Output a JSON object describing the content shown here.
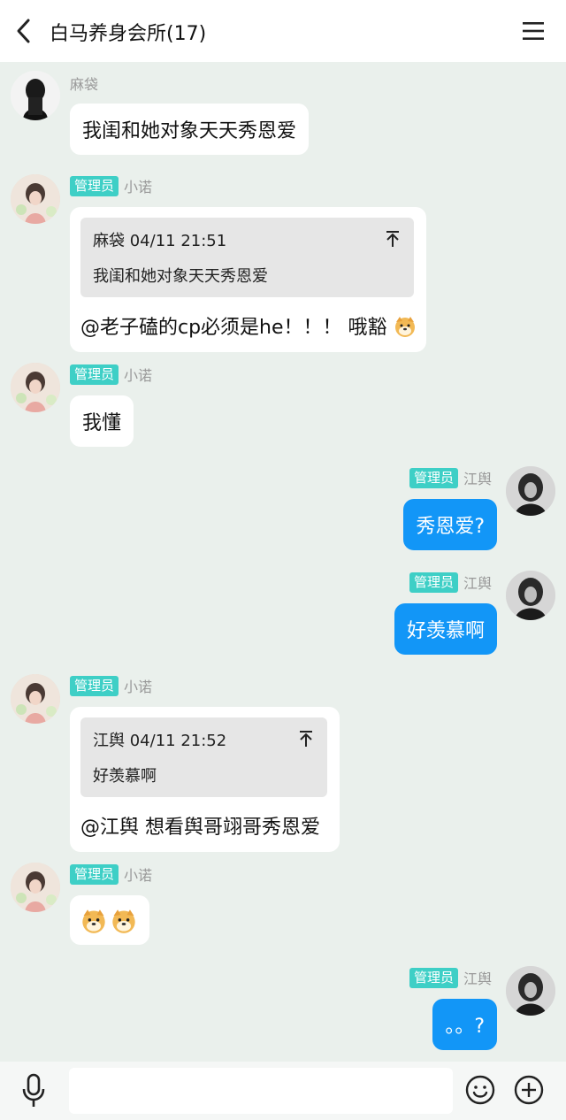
{
  "header": {
    "title": "白马养身会所(17)"
  },
  "messages": [
    {
      "sender": "麻袋",
      "text": "我闺和她对象天天秀恩爱"
    },
    {
      "badge": "管理员",
      "sender": "小诺",
      "quote": {
        "header": "麻袋 04/11 21:51",
        "text": "我闺和她对象天天秀恩爱"
      },
      "text": "@老子磕的cp必须是he！！！ 哦豁"
    },
    {
      "badge": "管理员",
      "sender": "小诺",
      "text": "我懂"
    },
    {
      "badge": "管理员",
      "sender": "江舆",
      "text": "秀恩爱?"
    },
    {
      "badge": "管理员",
      "sender": "江舆",
      "text": "好羡慕啊"
    },
    {
      "badge": "管理员",
      "sender": "小诺",
      "quote": {
        "header": "江舆 04/11 21:52",
        "text": "好羡慕啊"
      },
      "text": "@江舆 想看舆哥翊哥秀恩爱"
    },
    {
      "badge": "管理员",
      "sender": "小诺",
      "text": ""
    },
    {
      "badge": "管理员",
      "sender": "江舆",
      "text": "。。?"
    }
  ],
  "input": {
    "placeholder": ""
  },
  "icons": [
    "back-icon",
    "menu-icon",
    "avatar",
    "quote-jump-icon",
    "dog-emoji-icon",
    "mic-icon",
    "emoji-icon",
    "plus-icon"
  ]
}
